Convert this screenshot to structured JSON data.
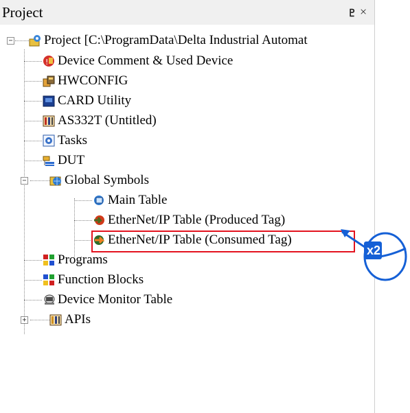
{
  "panel": {
    "title": "Project",
    "pin_glyph": "♇",
    "close_glyph": "×"
  },
  "tree": {
    "root": {
      "label": "Project [C:\\ProgramData\\Delta Industrial Automat",
      "expander": "−",
      "icon": "project-icon"
    },
    "items": [
      {
        "label": "Device Comment & Used Device",
        "icon": "device-comment-icon"
      },
      {
        "label": "HWCONFIG",
        "icon": "hwconfig-icon"
      },
      {
        "label": "CARD Utility",
        "icon": "card-utility-icon"
      },
      {
        "label": "AS332T  (Untitled)",
        "icon": "plc-program-icon"
      },
      {
        "label": "Tasks",
        "icon": "tasks-icon"
      },
      {
        "label": "DUT",
        "icon": "dut-icon"
      },
      {
        "label": "Global Symbols",
        "icon": "global-symbols-icon",
        "expander": "−"
      },
      {
        "label": "Main Table",
        "icon": "main-table-icon"
      },
      {
        "label": "EtherNet/IP Table (Produced Tag)",
        "icon": "produced-tag-icon"
      },
      {
        "label": "EtherNet/IP Table (Consumed Tag)",
        "icon": "consumed-tag-icon"
      },
      {
        "label": "Programs",
        "icon": "programs-icon"
      },
      {
        "label": "Function Blocks",
        "icon": "function-blocks-icon"
      },
      {
        "label": "Device Monitor Table",
        "icon": "device-monitor-icon"
      },
      {
        "label": "APIs",
        "icon": "apis-icon",
        "expander": "+"
      }
    ]
  },
  "callout": {
    "text": "x2",
    "color": "#1560d6"
  },
  "highlight_color": "#e3121e"
}
